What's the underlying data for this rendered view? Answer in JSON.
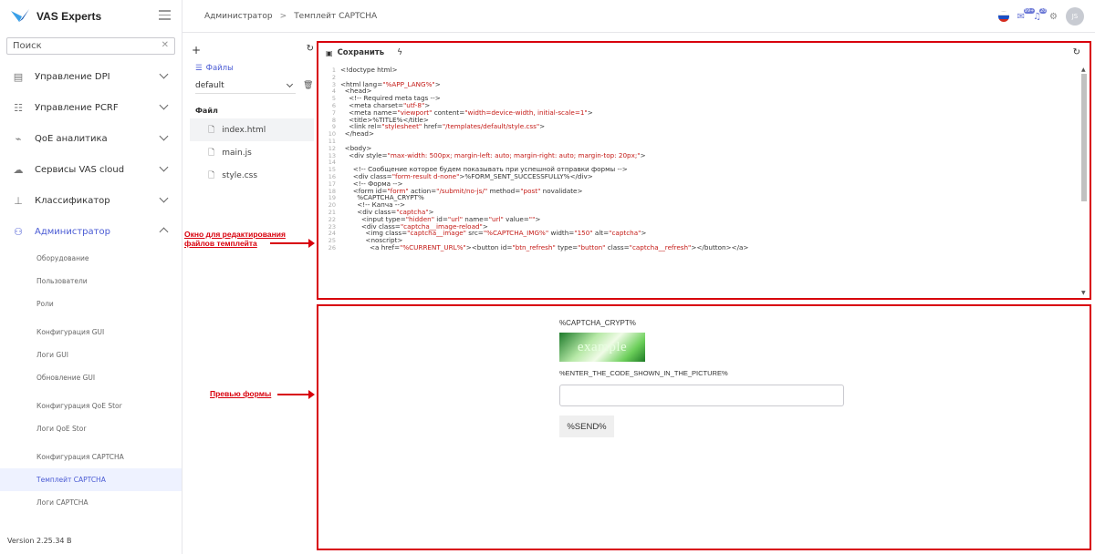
{
  "brand": {
    "name": "VAS Experts"
  },
  "search": {
    "placeholder": "Поиск"
  },
  "sidebar": {
    "items": [
      {
        "label": "Управление DPI",
        "icon": "server-icon"
      },
      {
        "label": "Управление PCRF",
        "icon": "sliders-icon"
      },
      {
        "label": "QoE аналитика",
        "icon": "chart-icon"
      },
      {
        "label": "Сервисы VAS cloud",
        "icon": "cloud-icon"
      },
      {
        "label": "Классификатор",
        "icon": "hierarchy-icon"
      },
      {
        "label": "Администратор",
        "icon": "users-icon"
      }
    ],
    "admin_sub": [
      "Оборудование",
      "Пользователи",
      "Роли",
      "Конфигурация GUI",
      "Логи GUI",
      "Обновление GUI",
      "Конфигурация QoE Stor",
      "Логи QoE Stor",
      "Конфигурация CAPTCHA",
      "Темплейт CAPTCHA",
      "Логи CAPTCHA"
    ],
    "version": "Version 2.25.34 B"
  },
  "header": {
    "breadcrumb_root": "Администратор",
    "breadcrumb_sep": ">",
    "breadcrumb_current": "Темплейт CAPTCHA",
    "badge_count": "99+",
    "badge_count2": "20",
    "avatar_initials": "JS"
  },
  "files_panel": {
    "files_label": "Файлы",
    "template_value": "default",
    "file_header": "Файл",
    "files": [
      "index.html",
      "main.js",
      "style.css"
    ]
  },
  "editor": {
    "save_label": "Сохранить",
    "code_lines": [
      "<!doctype html>",
      "",
      "<html lang=\"%APP_LANG%\">",
      "  <head>",
      "    <!-- Required meta tags -->",
      "    <meta charset=\"utf-8\">",
      "    <meta name=\"viewport\" content=\"width=device-width, initial-scale=1\">",
      "    <title>%TITLE%</title>",
      "    <link rel=\"stylesheet\" href=\"/templates/default/style.css\">",
      "  </head>",
      "",
      "  <body>",
      "    <div style=\"max-width: 500px; margin-left: auto; margin-right: auto; margin-top: 20px;\">",
      "",
      "      <!-- Сообщение которое будем показывать при успешной отправки формы -->",
      "      <div class=\"form-result d-none\">%FORM_SENT_SUCCESSFULLY%</div>",
      "      <!-- Форма -->",
      "      <form id=\"form\" action=\"/submit/no-js/\" method=\"post\" novalidate>",
      "        %CAPTCHA_CRYPT%",
      "        <!-- Капча -->",
      "        <div class=\"captcha\">",
      "          <input type=\"hidden\" id=\"url\" name=\"url\" value=\"\">",
      "          <div class=\"captcha__image-reload\">",
      "            <img class=\"captcha__image\" src=\"%CAPTCHA_IMG%\" width=\"150\" alt=\"captcha\">",
      "            <noscript>",
      "              <a href=\"%CURRENT_URL%\"><button id=\"btn_refresh\" type=\"button\" class=\"captcha__refresh\"></button></a>"
    ]
  },
  "preview": {
    "crypt": "%CAPTCHA_CRYPT%",
    "captcha_word": "example",
    "prompt": "%ENTER_THE_CODE_SHOWN_IN_THE_PICTURE%",
    "send_label": "%SEND%"
  },
  "annotations": {
    "editor_note_line1": "Окно для редактирования",
    "editor_note_line2": "файлов темплейта",
    "preview_note": "Превью формы"
  },
  "colors": {
    "accent": "#4a5bd4",
    "annotation": "#d8000c",
    "code_string": "#c41a16"
  }
}
